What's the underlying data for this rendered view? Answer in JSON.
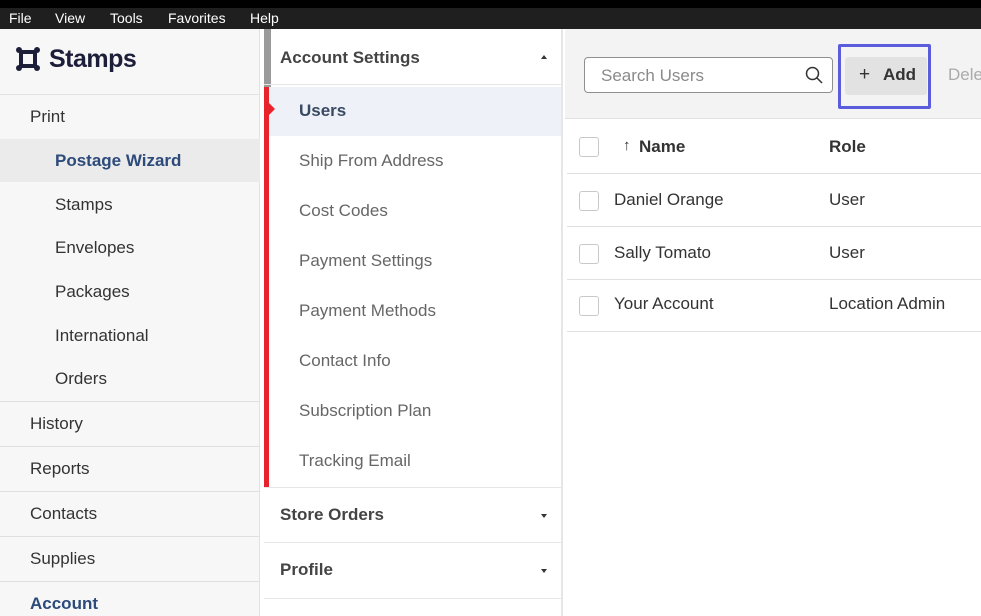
{
  "menubar": {
    "items": [
      {
        "label": "File"
      },
      {
        "label": "View"
      },
      {
        "label": "Tools"
      },
      {
        "label": "Favorites"
      },
      {
        "label": "Help"
      }
    ]
  },
  "brand": {
    "name": "Stamps",
    "color": "#1d1f3a"
  },
  "leftnav": {
    "print": "Print",
    "print_items": [
      {
        "label": "Postage Wizard",
        "selected": true
      },
      {
        "label": "Stamps"
      },
      {
        "label": "Envelopes"
      },
      {
        "label": "Packages"
      },
      {
        "label": "International"
      },
      {
        "label": "Orders"
      }
    ],
    "history": "History",
    "reports": "Reports",
    "contacts": "Contacts",
    "supplies": "Supplies",
    "account": "Account"
  },
  "settings": {
    "account_settings": "Account Settings",
    "items": [
      {
        "label": "Users",
        "selected": true
      },
      {
        "label": "Ship From Address"
      },
      {
        "label": "Cost Codes"
      },
      {
        "label": "Payment Settings"
      },
      {
        "label": "Payment Methods"
      },
      {
        "label": "Contact Info"
      },
      {
        "label": "Subscription Plan"
      },
      {
        "label": "Tracking Email"
      }
    ],
    "store_orders": "Store Orders",
    "profile": "Profile",
    "accent_color": "#e8232b"
  },
  "toolbar": {
    "search_placeholder": "Search Users",
    "add_label": "Add",
    "delete_label": "Dele",
    "highlight_color": "#5b5bdd"
  },
  "table": {
    "headers": {
      "name": "Name",
      "role": "Role"
    },
    "sort": "ascending",
    "rows": [
      {
        "name": "Daniel Orange",
        "role": "User"
      },
      {
        "name": "Sally Tomato",
        "role": "User"
      },
      {
        "name": "Your Account",
        "role": "Location Admin"
      }
    ]
  }
}
